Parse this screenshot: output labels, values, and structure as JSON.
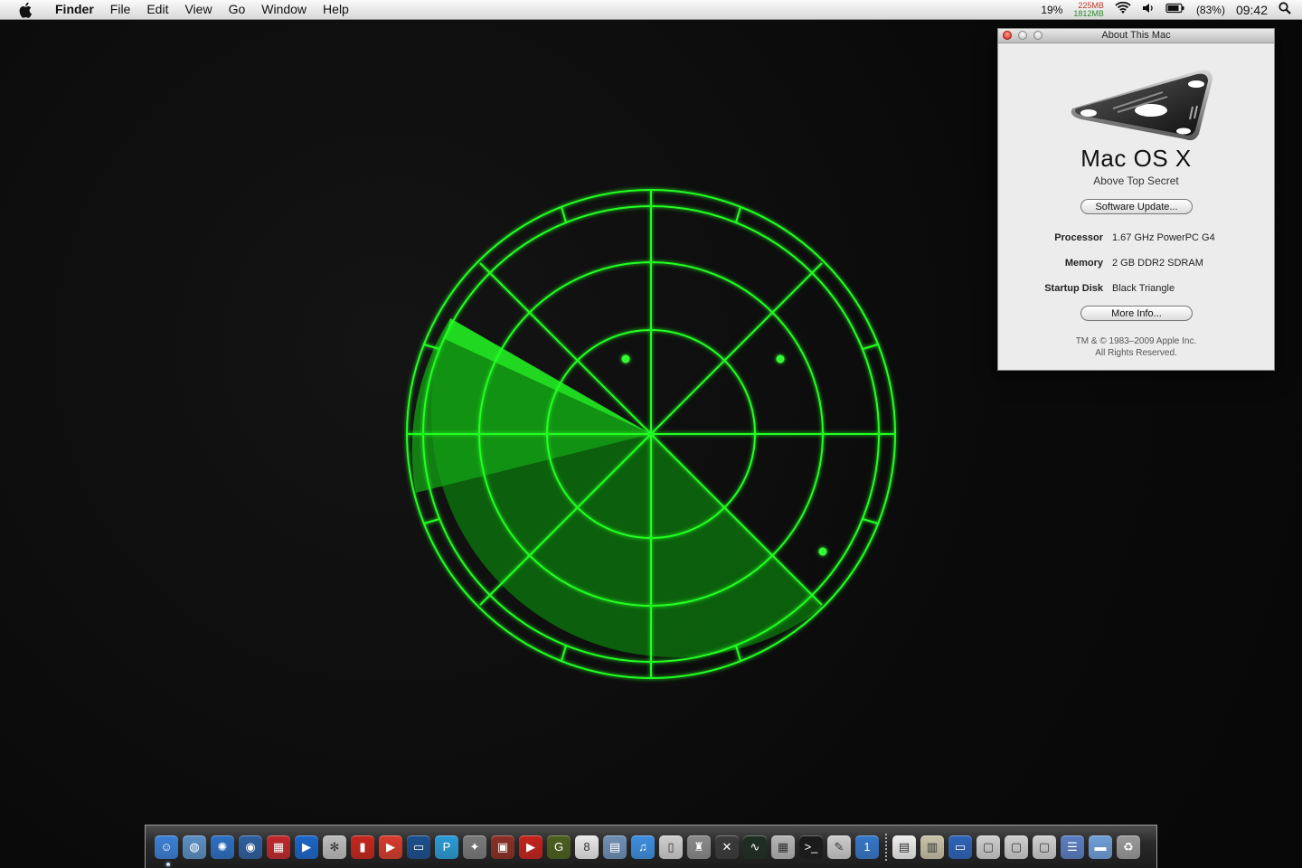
{
  "menubar": {
    "app_name": "Finder",
    "menus": [
      "File",
      "Edit",
      "View",
      "Go",
      "Window",
      "Help"
    ],
    "cpu": "19%",
    "mem_used": "225MB",
    "mem_free": "1812MB",
    "battery": "(83%)",
    "clock": "09:42"
  },
  "about": {
    "title": "About This Mac",
    "os_name": "Mac OS X",
    "os_subtitle": "Above Top Secret",
    "software_update_button": "Software Update...",
    "specs": [
      {
        "label": "Processor",
        "value": "1.67 GHz PowerPC G4"
      },
      {
        "label": "Memory",
        "value": "2 GB DDR2 SDRAM"
      },
      {
        "label": "Startup Disk",
        "value": "Black Triangle"
      }
    ],
    "more_info_button": "More Info...",
    "copyright_line1": "TM & © 1983–2009 Apple Inc.",
    "copyright_line2": "All Rights Reserved."
  },
  "radar": {
    "color": "#22ff22",
    "sweep_color": "#1fae1f",
    "blip_count": 3
  },
  "dock": {
    "apps": [
      {
        "name": "finder-icon",
        "color": "#3b7fd6",
        "glyph": "☺"
      },
      {
        "name": "network-globe-icon",
        "color": "#5a8fc4",
        "glyph": "◍"
      },
      {
        "name": "safari-icon",
        "color": "#2c6fc2",
        "glyph": "✺"
      },
      {
        "name": "earth-icon",
        "color": "#2d5e9e",
        "glyph": "◉"
      },
      {
        "name": "color-blocks-icon",
        "color": "#c0282b",
        "glyph": "▦"
      },
      {
        "name": "quicktime-icon",
        "color": "#1b65c8",
        "glyph": "▶"
      },
      {
        "name": "dvd-player-icon",
        "color": "#bdbdbd",
        "glyph": "✻"
      },
      {
        "name": "video-app-icon",
        "color": "#c6251c",
        "glyph": "▮"
      },
      {
        "name": "media-player-icon",
        "color": "#d83a2c",
        "glyph": "▶"
      },
      {
        "name": "screen-app-icon",
        "color": "#1b4f8c",
        "glyph": "▭"
      },
      {
        "name": "p-app-icon",
        "color": "#2a9bd6",
        "glyph": "P"
      },
      {
        "name": "magic-wand-icon",
        "color": "#7a7a7a",
        "glyph": "✦"
      },
      {
        "name": "film-strip-icon",
        "color": "#8a2f24",
        "glyph": "▣"
      },
      {
        "name": "youtube-icon",
        "color": "#c4221b",
        "glyph": "▶"
      },
      {
        "name": "glterm-icon",
        "color": "#4b5f1c",
        "glyph": "G"
      },
      {
        "name": "ical-icon",
        "color": "#e9e9e9",
        "glyph": "8"
      },
      {
        "name": "photos-icon",
        "color": "#6f8fb5",
        "glyph": "▤"
      },
      {
        "name": "itunes-icon",
        "color": "#3c8ee0",
        "glyph": "♫"
      },
      {
        "name": "device-icon",
        "color": "#cfcfcf",
        "glyph": "▯"
      },
      {
        "name": "trash-robot-icon",
        "color": "#8a8a8a",
        "glyph": "♜"
      },
      {
        "name": "osx-x-icon",
        "color": "#3a3a3a",
        "glyph": "✕"
      },
      {
        "name": "activity-monitor-icon",
        "color": "#1e2e22",
        "glyph": "∿"
      },
      {
        "name": "calculator-icon",
        "color": "#b5b5b5",
        "glyph": "▦"
      },
      {
        "name": "terminal-icon",
        "color": "#1a1a1a",
        "glyph": ">_"
      },
      {
        "name": "script-editor-icon",
        "color": "#cccccc",
        "glyph": "✎"
      },
      {
        "name": "info-1-icon",
        "color": "#3577c8",
        "glyph": "1"
      }
    ],
    "docs": [
      {
        "name": "jar-document-icon",
        "color": "#eeeeee",
        "glyph": "▤"
      },
      {
        "name": "preview-document-icon",
        "color": "#c9c2a8",
        "glyph": "▥"
      },
      {
        "name": "tv-icon",
        "color": "#2d63b8",
        "glyph": "▭"
      },
      {
        "name": "package-icon-1",
        "color": "#cfcfcf",
        "glyph": "▢"
      },
      {
        "name": "package-icon-2",
        "color": "#cfcfcf",
        "glyph": "▢"
      },
      {
        "name": "package-icon-3",
        "color": "#cfcfcf",
        "glyph": "▢"
      },
      {
        "name": "server-icon",
        "color": "#5a7ec4",
        "glyph": "☰"
      },
      {
        "name": "folder-icon",
        "color": "#6f9fd8",
        "glyph": "▬"
      },
      {
        "name": "trash-icon",
        "color": "#9a9a9a",
        "glyph": "♻"
      }
    ]
  }
}
